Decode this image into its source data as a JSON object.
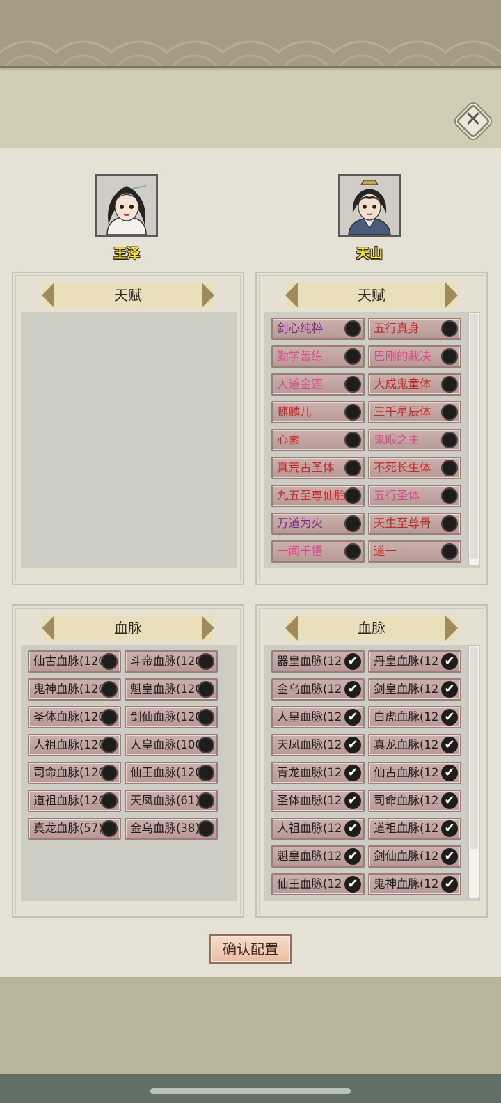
{
  "close_icon": "close-x-icon",
  "characters": [
    {
      "name": "王泽",
      "avatar_icon": "female-portrait-icon"
    },
    {
      "name": "天山",
      "avatar_icon": "male-portrait-icon"
    }
  ],
  "left_talent": {
    "title": "天赋",
    "items": []
  },
  "right_talent": {
    "title": "天赋",
    "items": [
      {
        "label": "剑心纯粹",
        "color": "#7a2a86"
      },
      {
        "label": "五行真身",
        "color": "#c42a2a"
      },
      {
        "label": "勤学苦练",
        "color": "#d84a8a"
      },
      {
        "label": "巴刚的裁决",
        "color": "#d84a8a"
      },
      {
        "label": "大道金莲",
        "color": "#d84a8a"
      },
      {
        "label": "大成鬼童体",
        "color": "#c42a2a"
      },
      {
        "label": "麒麟儿",
        "color": "#c42a2a"
      },
      {
        "label": "三千星辰体",
        "color": "#c42a2a"
      },
      {
        "label": "心素",
        "color": "#c42a2a"
      },
      {
        "label": "鬼眼之主",
        "color": "#d84a8a"
      },
      {
        "label": "真荒古圣体",
        "color": "#c42a2a"
      },
      {
        "label": "不死长生体",
        "color": "#c42a2a"
      },
      {
        "label": "九五至尊仙胎",
        "color": "#c42a2a"
      },
      {
        "label": "五行圣体",
        "color": "#d84a8a"
      },
      {
        "label": "万道为火",
        "color": "#7a2a86"
      },
      {
        "label": "天生至尊骨",
        "color": "#c42a2a"
      },
      {
        "label": "一闻千悟",
        "color": "#d84a8a"
      },
      {
        "label": "道一",
        "color": "#c42a2a"
      }
    ]
  },
  "left_bloodline": {
    "title": "血脉",
    "items": [
      "仙古血脉(120)",
      "斗帝血脉(120)",
      "鬼神血脉(120)",
      "魁皇血脉(120)",
      "圣体血脉(120)",
      "剑仙血脉(120)",
      "人祖血脉(120)",
      "人皇血脉(100)",
      "司命血脉(120)",
      "仙王血脉(120)",
      "道祖血脉(120)",
      "天凤血脉(61)",
      "真龙血脉(57)",
      "金乌血脉(38)"
    ]
  },
  "right_bloodline": {
    "title": "血脉",
    "items": [
      "器皇血脉(12",
      "丹皇血脉(12",
      "金乌血脉(12",
      "剑皇血脉(12",
      "人皇血脉(12",
      "白虎血脉(12",
      "天凤血脉(12",
      "真龙血脉(12",
      "青龙血脉(12",
      "仙古血脉(12",
      "圣体血脉(12",
      "司命血脉(12",
      "人祖血脉(12",
      "道祖血脉(12",
      "魁皇血脉(12",
      "剑仙血脉(12",
      "仙王血脉(12",
      "鬼神血脉(12"
    ]
  },
  "confirm_label": "确认配置"
}
